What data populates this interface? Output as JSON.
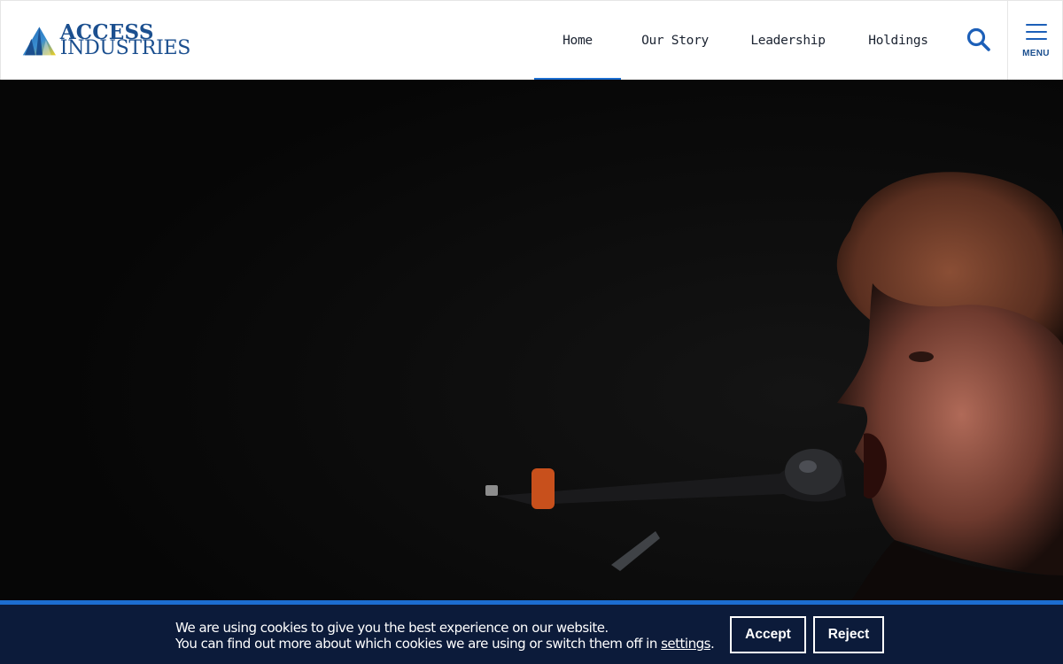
{
  "header": {
    "logo": {
      "line1": "ACCESS",
      "line2": "INDUSTRIES"
    },
    "nav": [
      {
        "label": "Home",
        "active": true
      },
      {
        "label": "Our Story",
        "active": false
      },
      {
        "label": "Leadership",
        "active": false
      },
      {
        "label": "Holdings",
        "active": false
      }
    ],
    "search_icon": "search-icon",
    "menu_label": "MENU"
  },
  "hero": {
    "type": "video-background"
  },
  "cookie_banner": {
    "line1": "We are using cookies to give you the best experience on our website.",
    "line2_prefix": "You can find out more about which cookies we are using or switch them off in ",
    "settings_link": "settings",
    "line2_suffix": ".",
    "accept_label": "Accept",
    "reject_label": "Reject"
  },
  "colors": {
    "brand_blue": "#1b4f8f",
    "accent_blue": "#1c6dd0",
    "logo_yellow": "#f2d11a",
    "cookie_bg": "#0c1b3a"
  }
}
